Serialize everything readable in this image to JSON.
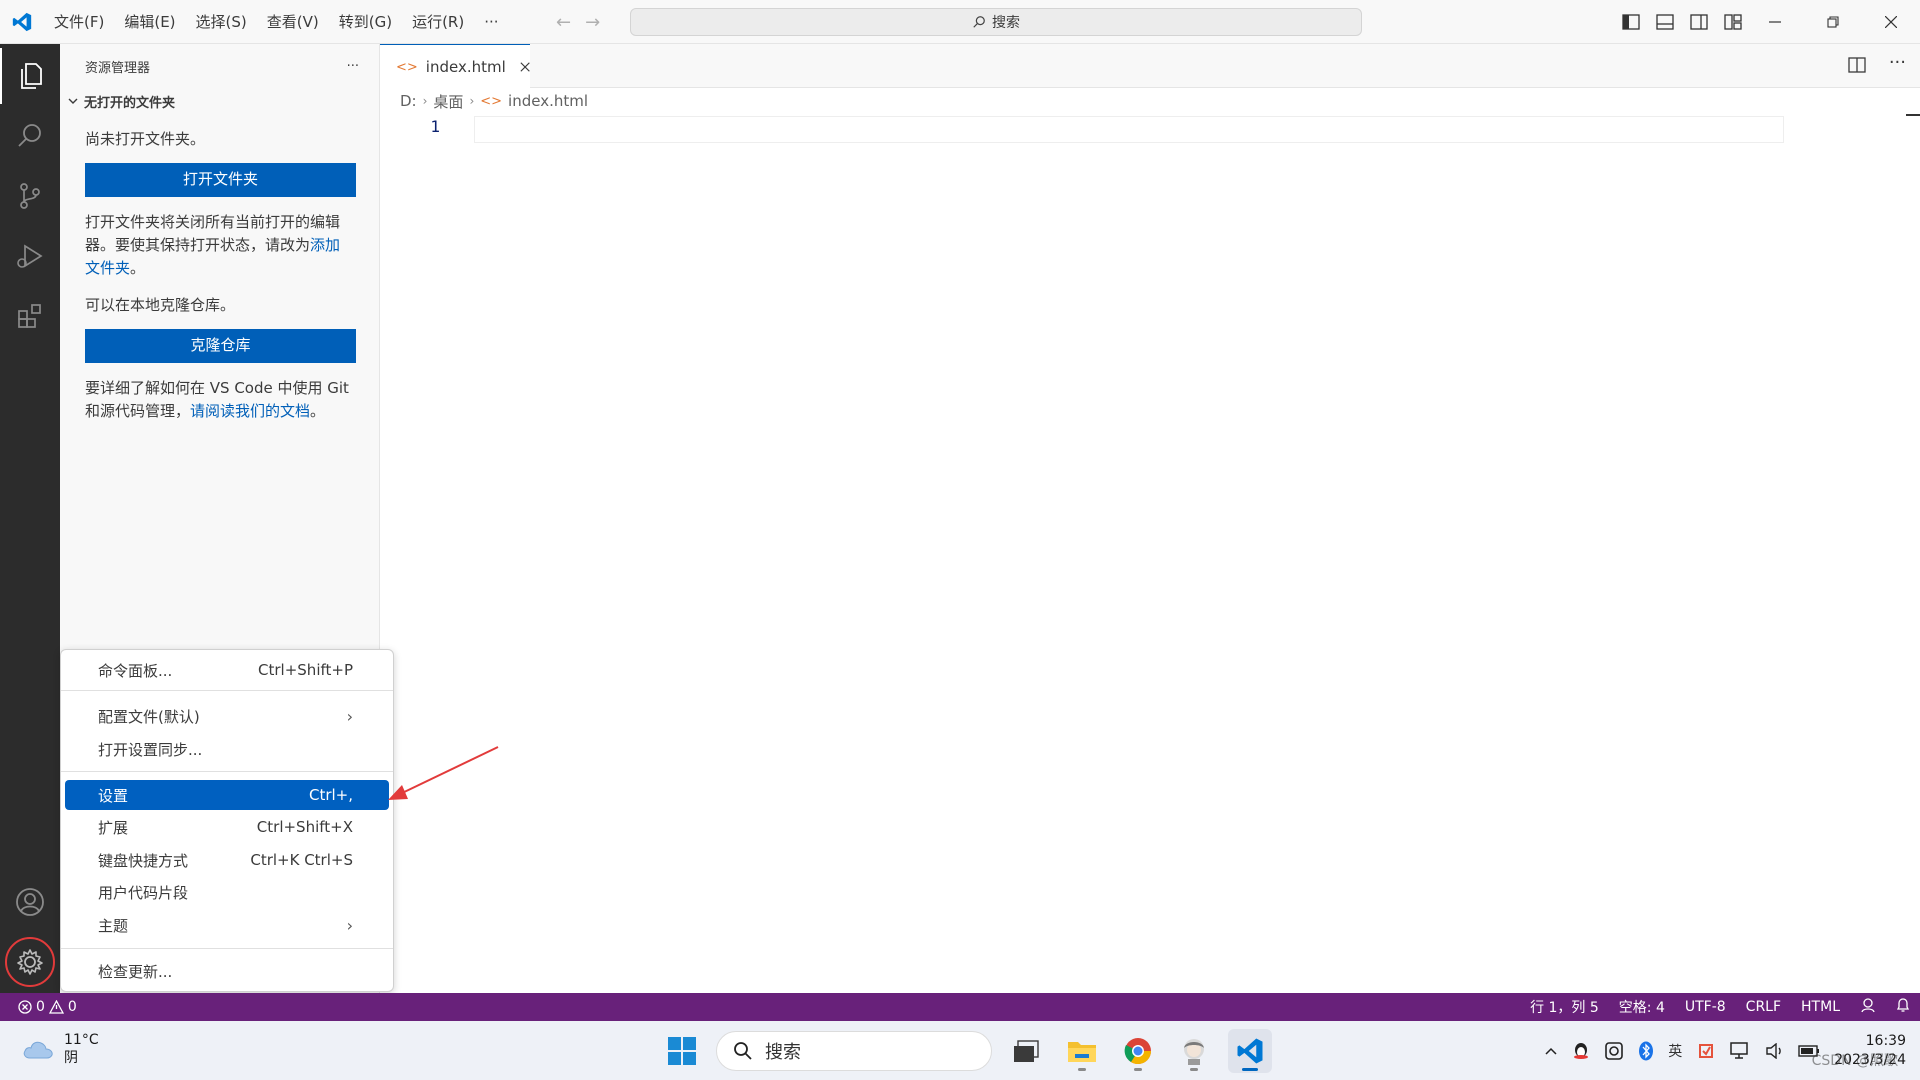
{
  "titlebar": {
    "menu": [
      "文件(F)",
      "编辑(E)",
      "选择(S)",
      "查看(V)",
      "转到(G)",
      "运行(R)",
      "···"
    ],
    "search_label": "搜索"
  },
  "sidebar": {
    "header_title": "资源管理器",
    "header_more": "···",
    "section_title": "无打开的文件夹",
    "no_folder_text": "尚未打开文件夹。",
    "open_folder_button": "打开文件夹",
    "open_folder_desc": "打开文件夹将关闭所有当前打开的编辑器。要使其保持打开状态，请改为",
    "add_folder_link": "添加文件夹",
    "add_folder_suffix": "。",
    "clone_desc": "可以在本地克隆仓库。",
    "clone_button": "克隆仓库",
    "learn_prefix": "要详细了解如何在 VS Code 中使用 Git 和源代码管理，",
    "learn_link": "请阅读我们的文档",
    "learn_suffix": "。"
  },
  "editor": {
    "tab_label": "index.html",
    "tab_lang_glyph": "<>",
    "breadcrumb": [
      "D:",
      "桌面",
      "index.html"
    ],
    "line_number": "1"
  },
  "context_menu": {
    "items": [
      {
        "label": "命令面板...",
        "shortcut": "Ctrl+Shift+P"
      },
      {
        "label": "配置文件(默认)",
        "shortcut": "›"
      },
      {
        "label": "打开设置同步...",
        "shortcut": ""
      },
      {
        "label": "设置",
        "shortcut": "Ctrl+,"
      },
      {
        "label": "扩展",
        "shortcut": "Ctrl+Shift+X"
      },
      {
        "label": "键盘快捷方式",
        "shortcut": "Ctrl+K Ctrl+S"
      },
      {
        "label": "用户代码片段",
        "shortcut": ""
      },
      {
        "label": "主题",
        "shortcut": "›"
      },
      {
        "label": "检查更新...",
        "shortcut": ""
      }
    ],
    "selected_index": 3
  },
  "statusbar": {
    "errors": "0",
    "warnings": "0",
    "position": "行 1，列 5",
    "spaces": "空格: 4",
    "encoding": "UTF-8",
    "eol": "CRLF",
    "language": "HTML"
  },
  "taskbar": {
    "temperature": "11°C",
    "weather": "阴",
    "search_label": "搜索",
    "time": "16:39",
    "date": "2023/3/24",
    "watermark": "CSDN @照歌"
  },
  "colors": {
    "accent": "#005fb8",
    "statusbar": "#68217a",
    "activitybar": "#2c2c2c",
    "annotation": "#e23b3b"
  }
}
